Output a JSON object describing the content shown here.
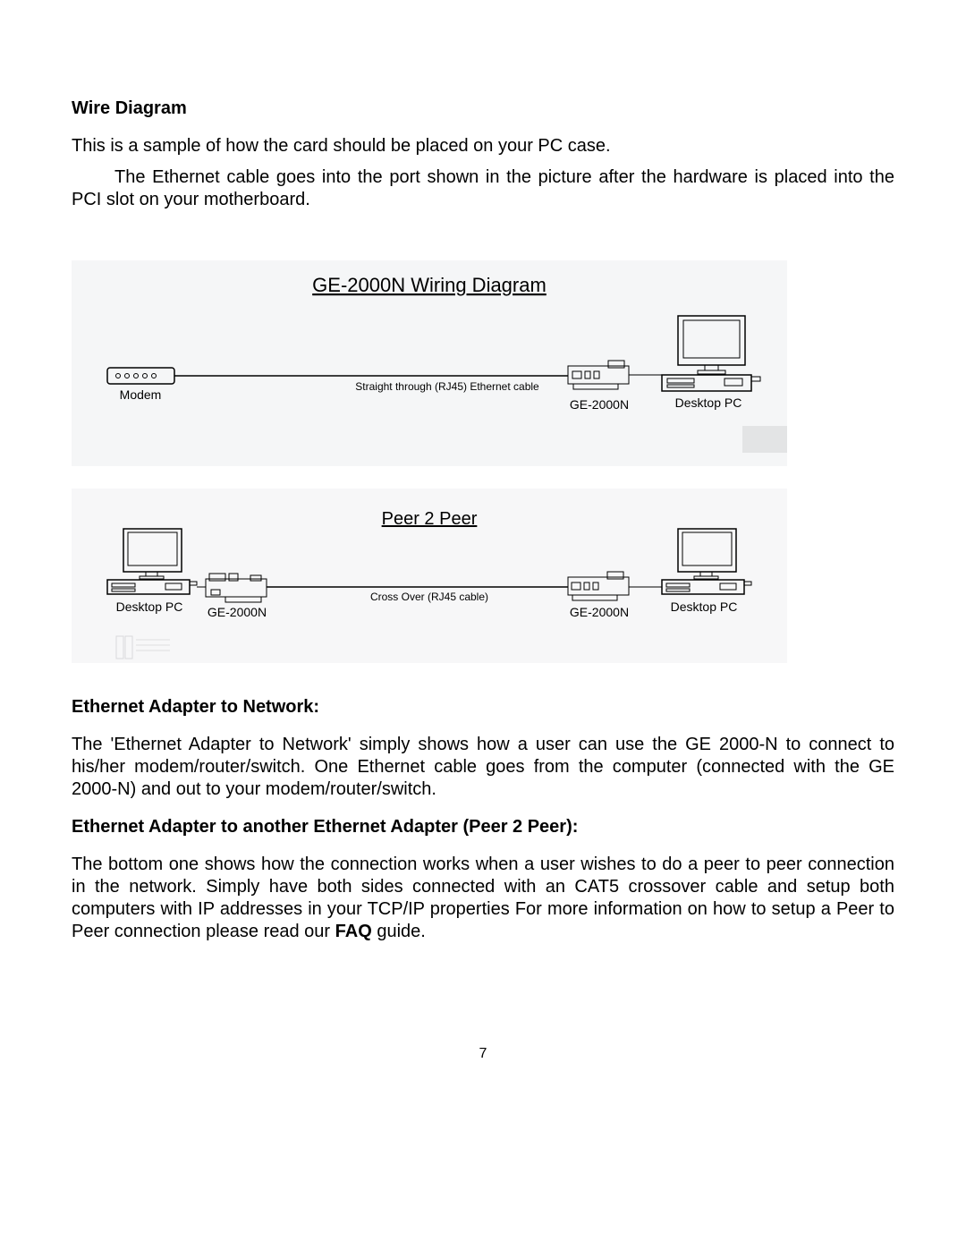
{
  "page_number": "7",
  "sections": {
    "wire_diagram": {
      "heading": "Wire Diagram",
      "p1": "This is a sample of how the card should be placed on your PC case.",
      "p2": "The Ethernet cable goes into the port shown in the picture after the hardware is placed into the PCI slot on your motherboard."
    },
    "diagram": {
      "top_title": "GE-2000N Wiring Diagram",
      "modem_label": "Modem",
      "cable1_label": "Straight through (RJ45) Ethernet cable",
      "card_label": "GE-2000N",
      "pc_label": "Desktop PC",
      "bottom_title": "Peer 2 Peer",
      "cable2_label": "Cross Over (RJ45 cable)"
    },
    "adapter_network": {
      "heading": "Ethernet Adapter to Network:",
      "p1": "The 'Ethernet Adapter to Network' simply shows how a user can use the GE 2000-N to connect to his/her modem/router/switch.  One Ethernet cable goes from the computer (connected with the GE 2000-N) and out to your modem/router/switch."
    },
    "adapter_peer": {
      "heading": "Ethernet Adapter to another Ethernet Adapter (Peer 2 Peer):",
      "p1_a": "The bottom one shows how the connection works when a user wishes to do a peer to peer connection in the network.  Simply have both sides connected with an CAT5 crossover cable and setup both computers with IP addresses in your TCP/IP properties  For more information on how to setup a Peer to Peer connection please read our ",
      "p1_bold": "FAQ",
      "p1_b": " guide."
    }
  }
}
